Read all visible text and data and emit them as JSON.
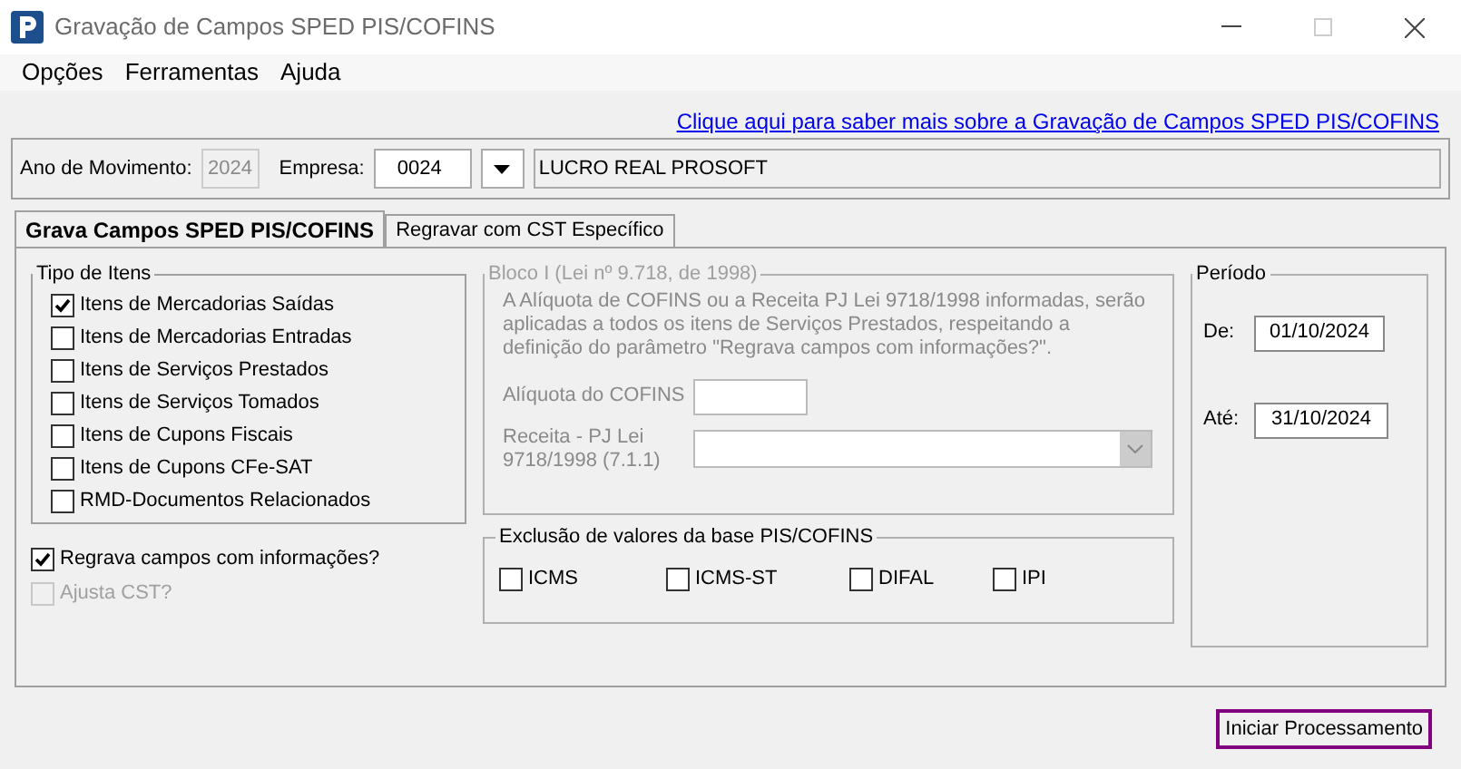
{
  "window": {
    "title": "Gravação de Campos SPED PIS/COFINS"
  },
  "menu": [
    "Opções",
    "Ferramentas",
    "Ajuda"
  ],
  "help_link": "Clique aqui para saber mais sobre a Gravação de Campos SPED PIS/COFINS",
  "header": {
    "year_label": "Ano de Movimento:",
    "year": {
      "value": "2024",
      "disabled": true
    },
    "company_label": "Empresa:",
    "company_code": "0024",
    "company_name": "LUCRO REAL PROSOFT"
  },
  "tabs": [
    {
      "label": "Grava Campos SPED PIS/COFINS",
      "selected": true
    },
    {
      "label": "Regravar com CST Específico",
      "selected": false
    }
  ],
  "item_types": {
    "title": "Tipo de Itens",
    "items": [
      {
        "label": "Itens de Mercadorias Saídas",
        "checked": true
      },
      {
        "label": "Itens de Mercadorias Entradas",
        "checked": false
      },
      {
        "label": "Itens de Serviços Prestados",
        "checked": false
      },
      {
        "label": "Itens de Serviços Tomados",
        "checked": false
      },
      {
        "label": "Itens de Cupons Fiscais",
        "checked": false
      },
      {
        "label": "Itens de Cupons CFe-SAT",
        "checked": false
      },
      {
        "label": "RMD-Documentos Relacionados",
        "checked": false
      }
    ]
  },
  "options": [
    {
      "label": "Regrava campos com informações?",
      "checked": true,
      "disabled": false
    },
    {
      "label": "Ajusta CST?",
      "checked": false,
      "disabled": true
    }
  ],
  "bloco": {
    "title": "Bloco I (Lei nº 9.718, de 1998)",
    "disabled": true,
    "description": "A Alíquota de COFINS ou a Receita PJ Lei 9718/1998 informadas, serão aplicadas a todos os itens de Serviços Prestados, respeitando a definição do parâmetro \"Regrava campos com informações?\".",
    "rate_label": "Alíquota do COFINS",
    "revenue_label": "Receita - PJ Lei 9718/1998 (7.1.1)"
  },
  "exclusion": {
    "title": "Exclusão de valores da base PIS/COFINS",
    "items": [
      {
        "label": "ICMS",
        "checked": false
      },
      {
        "label": "ICMS-ST",
        "checked": false
      },
      {
        "label": "DIFAL",
        "checked": false
      },
      {
        "label": "IPI",
        "checked": false
      }
    ]
  },
  "period": {
    "title": "Período",
    "from_label": "De:",
    "from": "01/10/2024",
    "to_label": "Até:",
    "to": "31/10/2024"
  },
  "start_button": "Iniciar Processamento"
}
